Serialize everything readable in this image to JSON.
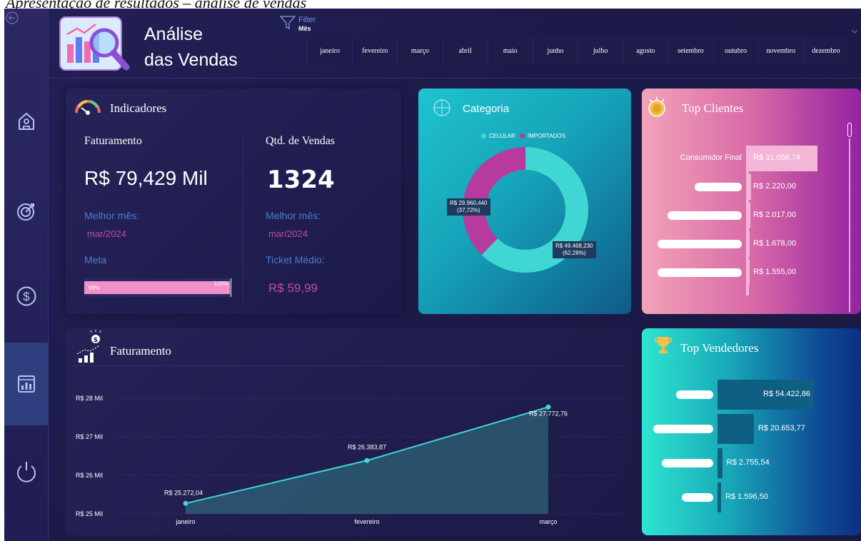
{
  "caption": "Apresentação de resultados – análise de vendas",
  "header": {
    "title_line1": "Análise",
    "title_line2": "das Vendas",
    "filter_label": "Filter",
    "filter_field": "Mês",
    "months": [
      "janeiro",
      "fevereiro",
      "março",
      "abril",
      "maio",
      "junho",
      "julho",
      "agosto",
      "setembro",
      "outubro",
      "novembro",
      "dezembro"
    ]
  },
  "sidebar": {
    "items": [
      {
        "icon": "home-icon"
      },
      {
        "icon": "target-icon"
      },
      {
        "icon": "dollar-icon"
      },
      {
        "icon": "report-icon",
        "active": true
      },
      {
        "icon": "power-icon"
      }
    ]
  },
  "indicadores": {
    "title": "Indicadores",
    "faturamento_label": "Faturamento",
    "faturamento_value": "R$ 79,429 Mil",
    "qtd_label": "Qtd. de Vendas",
    "qtd_value": "1324",
    "melhor_mes_label": "Melhor mês:",
    "melhor_mes_fat": "mar/2024",
    "melhor_mes_qtd": "mar/2024",
    "meta_label": "Meta",
    "meta_progress": 0.99,
    "meta_progress_label": "99%",
    "meta_target_label": "100%",
    "ticket_label": "Ticket Médio:",
    "ticket_value": "R$ 59,99"
  },
  "categoria": {
    "title": "Categoria",
    "legend": [
      {
        "label": "CELULAR",
        "color": "#3fd6d3"
      },
      {
        "label": "IMPORTADOS",
        "color": "#b73b9e"
      }
    ],
    "importados_label": "R$ 29.960,440",
    "importados_pct": "(37,72%)",
    "celular_label": "R$ 49.468,230",
    "celular_pct": "(62,28%)"
  },
  "top_clientes": {
    "title": "Top Clientes",
    "rows": [
      {
        "name": "Consumidor Final",
        "value": "R$ 31.056,74"
      },
      {
        "name": "",
        "value": "R$ 2.220,00"
      },
      {
        "name": "",
        "value": "R$ 2.017,00"
      },
      {
        "name": "",
        "value": "R$ 1.678,00"
      },
      {
        "name": "",
        "value": "R$ 1.555,00"
      }
    ]
  },
  "faturamento_chart": {
    "title": "Faturamento"
  },
  "top_vendedores": {
    "title": "Top Vendedores",
    "rows": [
      {
        "value": "R$ 54.422,86"
      },
      {
        "value": "R$ 20.653,77"
      },
      {
        "value": "R$ 2.755,54"
      },
      {
        "value": "R$ 1.596,50"
      }
    ]
  },
  "chart_data": [
    {
      "type": "area",
      "title": "Faturamento",
      "categories": [
        "janeiro",
        "fevereiro",
        "março"
      ],
      "values": [
        25272.04,
        26383.87,
        27772.76
      ],
      "value_labels": [
        "R$ 25.272,04",
        "R$ 26.383,87",
        "R$ 27.772,76"
      ],
      "y_ticks": [
        "R$ 25 Mil",
        "R$ 26 Mil",
        "R$ 27 Mil",
        "R$ 28 Mil"
      ],
      "ylim": [
        25000,
        28000
      ],
      "color": "#3fd6d3"
    },
    {
      "type": "pie",
      "title": "Categoria",
      "labels": [
        "CELULAR",
        "IMPORTADOS"
      ],
      "values": [
        49468.23,
        29960.44
      ],
      "percent": [
        62.28,
        37.72
      ],
      "colors": [
        "#3fd6d3",
        "#b73b9e"
      ]
    },
    {
      "type": "bar",
      "title": "Top Clientes",
      "categories": [
        "Consumidor Final",
        "",
        "",
        "",
        ""
      ],
      "values": [
        31056.74,
        2220.0,
        2017.0,
        1678.0,
        1555.0
      ]
    },
    {
      "type": "bar",
      "title": "Top Vendedores",
      "categories": [
        "",
        "",
        "",
        ""
      ],
      "values": [
        54422.86,
        20653.77,
        2755.54,
        1596.5
      ]
    }
  ]
}
